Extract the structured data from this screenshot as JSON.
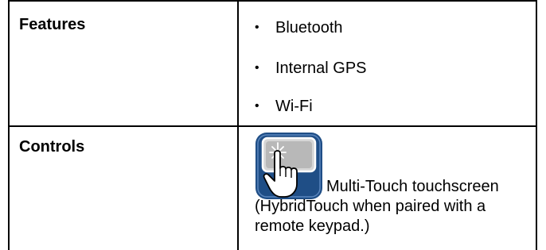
{
  "table": {
    "features": {
      "label": "Features",
      "items": [
        "Bluetooth",
        "Internal GPS",
        "Wi-Fi"
      ]
    },
    "controls": {
      "label": "Controls",
      "icon": "touch-hand-icon",
      "description": "Multi-Touch touchscreen (HybridTouch when paired with a remote keypad.)"
    }
  },
  "colors": {
    "border": "#000000",
    "icon_blue": "#1f4e86",
    "icon_panel": "#b8b8b8"
  }
}
